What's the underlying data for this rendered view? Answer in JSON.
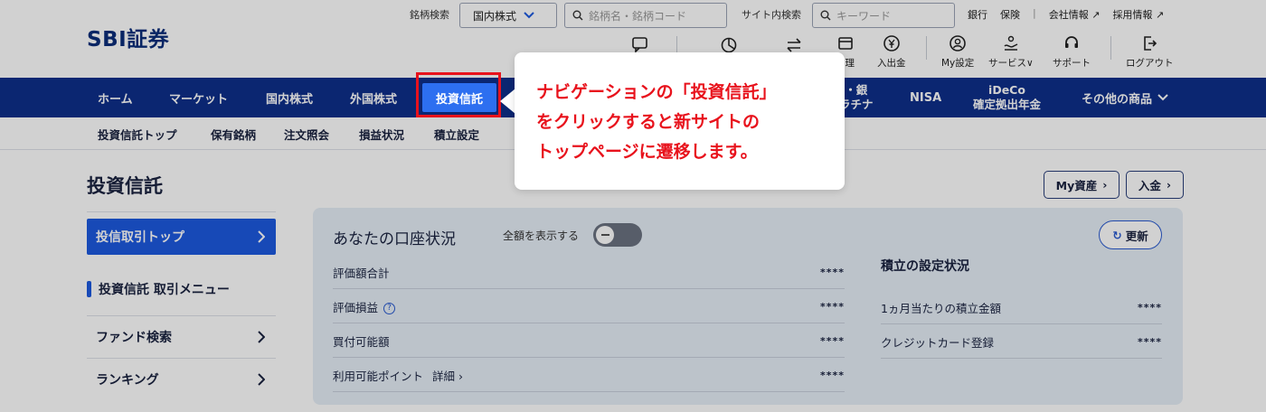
{
  "brand": {
    "logo": "SBI証券"
  },
  "header": {
    "symbol_search_label": "銘柄検索",
    "market_select": "国内株式",
    "symbol_search_placeholder": "銘柄名・銘柄コード",
    "site_search_label": "サイト内検索",
    "site_search_placeholder": "キーワード",
    "util_links": [
      "銀行",
      "保険",
      "会社情報",
      "採用情報"
    ],
    "icons": [
      {
        "label": "管理",
        "icon": "portfolio-icon"
      },
      {
        "label": "入出金",
        "icon": "yen-icon"
      },
      {
        "label": "My設定",
        "icon": "user-settings-icon"
      },
      {
        "label": "サービス",
        "icon": "service-icon"
      },
      {
        "label": "サポート",
        "icon": "headset-icon"
      },
      {
        "label": "ログアウト",
        "icon": "logout-icon"
      }
    ]
  },
  "nav": {
    "items": [
      "ホーム",
      "マーケット",
      "国内株式",
      "外国株式",
      "投資信託",
      "・銀",
      "ラチナ",
      "NISA",
      "iDeCo",
      "確定拠出年金",
      "その他の商品"
    ],
    "active": "投資信託"
  },
  "subnav": {
    "items": [
      "投資信託トップ",
      "保有銘柄",
      "注文照会",
      "損益状況",
      "積立設定"
    ]
  },
  "page": {
    "title": "投資信託",
    "my_assets_button": "My資産",
    "deposit_button": "入金"
  },
  "sidebar": {
    "top_item": "投信取引トップ",
    "menu_heading": "投資信託 取引メニュー",
    "items": [
      "ファンド検索",
      "ランキング"
    ]
  },
  "account": {
    "title": "あなたの口座状況",
    "toggle_label": "全額を表示する",
    "refresh_label": "更新",
    "rows": [
      {
        "label": "評価額合計",
        "value": "****"
      },
      {
        "label": "評価損益",
        "value": "****"
      },
      {
        "label": "買付可能額",
        "value": "****"
      },
      {
        "label": "利用可能ポイント",
        "link": "詳細",
        "value": "****"
      }
    ],
    "reserve_title": "積立の設定状況",
    "reserve_rows": [
      {
        "label": "1ヵ月当たりの積立金額",
        "value": "****"
      },
      {
        "label": "クレジットカード登録",
        "value": "****"
      }
    ]
  },
  "callout": {
    "lines": [
      "ナビゲーションの「投資信託」",
      "をクリックすると新サイトの",
      "トップページに遷移します。"
    ],
    "color": "#e8121c"
  }
}
